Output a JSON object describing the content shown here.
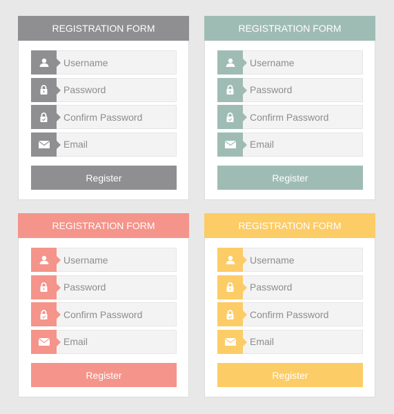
{
  "forms": [
    {
      "theme": "gray",
      "accent": "#8f8f92",
      "title": "REGISTRATION FORM",
      "fields": [
        {
          "icon": "user-icon",
          "placeholder": "Username",
          "value": ""
        },
        {
          "icon": "lock-icon",
          "placeholder": "Password",
          "value": ""
        },
        {
          "icon": "lock-check-icon",
          "placeholder": "Confirm Password",
          "value": ""
        },
        {
          "icon": "envelope-icon",
          "placeholder": "Email",
          "value": ""
        }
      ],
      "button_label": "Register"
    },
    {
      "theme": "sage",
      "accent": "#9fbcb4",
      "title": "REGISTRATION FORM",
      "fields": [
        {
          "icon": "user-icon",
          "placeholder": "Username",
          "value": ""
        },
        {
          "icon": "lock-icon",
          "placeholder": "Password",
          "value": ""
        },
        {
          "icon": "lock-check-icon",
          "placeholder": "Confirm Password",
          "value": ""
        },
        {
          "icon": "envelope-icon",
          "placeholder": "Email",
          "value": ""
        }
      ],
      "button_label": "Register"
    },
    {
      "theme": "salmon",
      "accent": "#f4948a",
      "title": "REGISTRATION FORM",
      "fields": [
        {
          "icon": "user-icon",
          "placeholder": "Username",
          "value": ""
        },
        {
          "icon": "lock-icon",
          "placeholder": "Password",
          "value": ""
        },
        {
          "icon": "lock-check-icon",
          "placeholder": "Confirm Password",
          "value": ""
        },
        {
          "icon": "envelope-icon",
          "placeholder": "Email",
          "value": ""
        }
      ],
      "button_label": "Register"
    },
    {
      "theme": "yellow",
      "accent": "#fccc66",
      "title": "REGISTRATION FORM",
      "fields": [
        {
          "icon": "user-icon",
          "placeholder": "Username",
          "value": ""
        },
        {
          "icon": "lock-icon",
          "placeholder": "Password",
          "value": ""
        },
        {
          "icon": "lock-check-icon",
          "placeholder": "Confirm Password",
          "value": ""
        },
        {
          "icon": "envelope-icon",
          "placeholder": "Email",
          "value": ""
        }
      ],
      "button_label": "Register"
    }
  ]
}
